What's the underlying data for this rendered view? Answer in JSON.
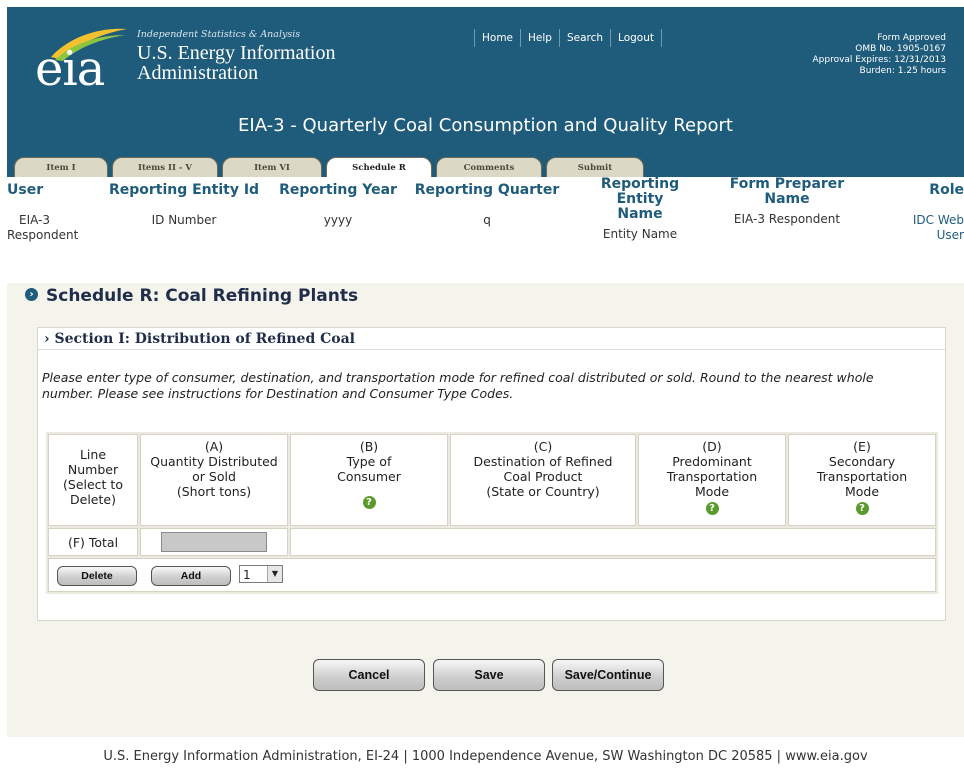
{
  "header": {
    "tagline": "Independent Statistics & Analysis",
    "org_line1": "U.S. Energy Information",
    "org_line2": "Administration",
    "logo_text": "eia",
    "nav": [
      "Home",
      "Help",
      "Search",
      "Logout"
    ],
    "omb": [
      "Form Approved",
      "OMB No. 1905-0167",
      "Approval Expires: 12/31/2013",
      "Burden: 1.25 hours"
    ],
    "form_title": "EIA-3 - Quarterly Coal Consumption and Quality Report"
  },
  "tabs": [
    {
      "label": "Item I",
      "active": false
    },
    {
      "label": "Items II - V",
      "active": false
    },
    {
      "label": "Item VI",
      "active": false
    },
    {
      "label": "Schedule R",
      "active": true
    },
    {
      "label": "Comments",
      "active": false
    },
    {
      "label": "Submit",
      "active": false
    }
  ],
  "userbar": {
    "user": {
      "head": "User",
      "value_line1": "EIA-3",
      "value_line2": "Respondent"
    },
    "entity_id": {
      "head": "Reporting Entity Id",
      "value": "ID Number"
    },
    "year": {
      "head": "Reporting Year",
      "value": "yyyy"
    },
    "quarter": {
      "head": "Reporting Quarter",
      "value": "q"
    },
    "entity_name": {
      "head_line1": "Reporting Entity",
      "head_line2": "Name",
      "value": "Entity Name"
    },
    "preparer": {
      "head_line1": "Form Preparer",
      "head_line2": "Name",
      "value": "EIA-3 Respondent"
    },
    "role": {
      "head": "Role",
      "value_line1": "IDC Web",
      "value_line2": "User"
    }
  },
  "schedule": {
    "title": "Schedule R: Coal Refining Plants",
    "section_title": "› Section I: Distribution of Refined Coal",
    "instructions": "Please enter type of consumer, destination, and transportation mode for refined coal distributed or sold. Round to the nearest whole number. Please see instructions for Destination and Consumer Type Codes."
  },
  "table": {
    "columns": [
      {
        "lines": [
          "Line",
          "Number",
          "(Select to",
          "Delete)"
        ]
      },
      {
        "lines": [
          "(A)",
          "Quantity Distributed",
          "or Sold",
          "(Short tons)"
        ]
      },
      {
        "lines": [
          "(B)",
          "Type of",
          "Consumer"
        ]
      },
      {
        "lines": [
          "(C)",
          "Destination of Refined",
          "Coal Product",
          "(State or Country)"
        ]
      },
      {
        "lines": [
          "(D)",
          "Predominant",
          "Transportation",
          "Mode"
        ]
      },
      {
        "lines": [
          "(E)",
          "Secondary",
          "Transportation",
          "Mode"
        ]
      }
    ],
    "help_glyph": "?",
    "total_label": "(F) Total"
  },
  "row_controls": {
    "delete_label": "Delete",
    "add_label": "Add",
    "add_count": "1",
    "dropdown_glyph": "▼"
  },
  "actions": {
    "cancel": "Cancel",
    "save": "Save",
    "save_continue": "Save/Continue"
  },
  "footer": {
    "text": "U.S. Energy Information Administration, EI-24 | 1000 Independence Avenue, SW Washington DC 20585  | www.eia.gov"
  },
  "colors": {
    "header_bg": "#1f5c7c",
    "page_bg": "#f4f4ec",
    "help_green": "#5a9a2a"
  }
}
